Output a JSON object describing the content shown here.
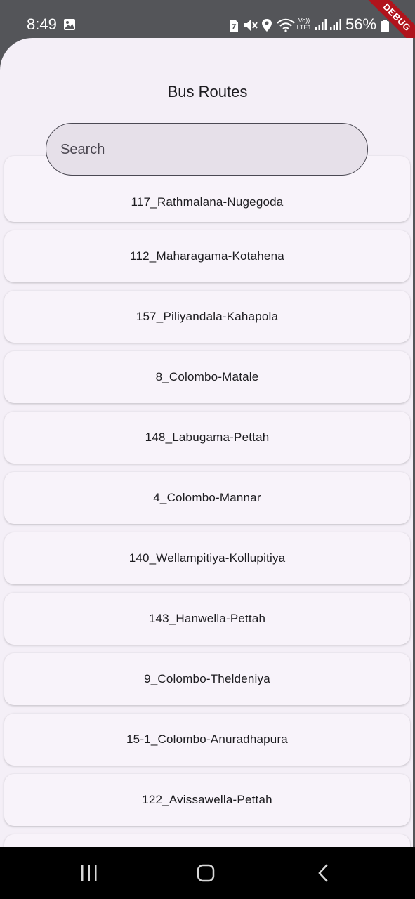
{
  "status_bar": {
    "time": "8:49",
    "battery_text": "56%",
    "icons": [
      "gallery-icon",
      "sim-icon",
      "mute-icon",
      "location-icon",
      "wifi-icon",
      "lte-icon",
      "signal-icon",
      "battery-icon"
    ],
    "lte_label": "Vo)) LTE1"
  },
  "debug_banner": "DEBUG",
  "app": {
    "title": "Bus Routes",
    "search": {
      "placeholder": "Search",
      "value": ""
    },
    "routes": [
      "117_Rathmalana-Nugegoda",
      "112_Maharagama-Kotahena",
      "157_Piliyandala-Kahapola",
      "8_Colombo-Matale",
      "148_Labugama-Pettah",
      "4_Colombo-Mannar",
      "140_Wellampitiya-Kollupitiya",
      "143_Hanwella-Pettah",
      "9_Colombo-Theldeniya",
      "15-1_Colombo-Anuradhapura",
      "122_Avissawella-Pettah",
      ""
    ]
  },
  "colors": {
    "background": "#f4eff7",
    "card": "#f8f3fa",
    "search_fill": "#e6e0e9",
    "status_bar": "#545559",
    "nav_bar": "#000000",
    "debug_ribbon": "#b0141c"
  },
  "nav_bar": {
    "buttons": [
      "recents-button",
      "home-button",
      "back-button"
    ]
  }
}
